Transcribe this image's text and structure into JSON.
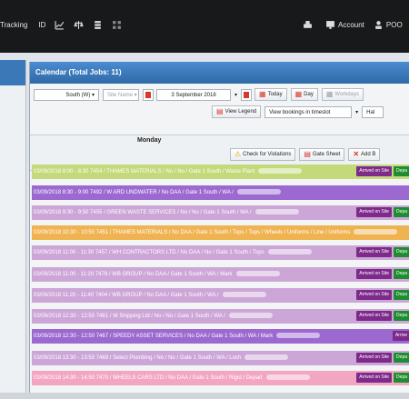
{
  "topbar": {
    "items": [
      "Tracking",
      "ID"
    ],
    "account_label": "Account",
    "user_label": "POO",
    "icons": [
      "chart-icon",
      "scales-icon",
      "stack-icon",
      "grid-icon",
      "printer-icon",
      "monitor-icon",
      "user-icon"
    ]
  },
  "calendar": {
    "title": "Calendar (Total Jobs: 11)",
    "location_select": "South (W) ▾",
    "site_select": "Site Name ▾",
    "date_select": "3 September 2018",
    "today_label": "Today",
    "day_label": "Day",
    "workdays_label": "Workdays",
    "view_legend_label": "View Legend",
    "view_bookings_select": "View bookings in timeslot",
    "hour_select": "Hal",
    "day_name": "Monday",
    "check_violations_label": "Check for Violations",
    "gate_sheet_label": "Gate Sheet",
    "add_label": "Add B",
    "rows": [
      {
        "text": "03/09/2018 8:00 - 8:30 7454 / THAMES MATERIALS / No / No / Gate 1 South / Waste Plant",
        "color": "#c3d97a",
        "tags": [
          "Arrived on Site",
          "Depa"
        ]
      },
      {
        "text": "03/09/2018 8:30 - 9:00 7492 / W ARD UNDWATER / No DAA / Gate 1 South / WA /",
        "color": "#9c69d0",
        "tags": []
      },
      {
        "text": "03/09/2018 9:30 - 9:50 7455 / GREEN WASTE SERVICES / No / No / Gate 1 South / WA /",
        "color": "#cda6d8",
        "tags": [
          "Arrived on Site",
          "Depa"
        ]
      },
      {
        "text": "03/09/2018 10:30 - 10:50 7451 / THAMES MATERIALS / No DAA / Gate 1 South / Tops / Tops / Wheels / Uniforms / Line / Uniforms",
        "color": "#f0b352",
        "tags": []
      },
      {
        "text": "03/09/2018 11:00 - 11:30 7457 / WH CONTRACTORS LTD / No DAA / No / Gate 1 South / Tops",
        "color": "#cda6d8",
        "tags": [
          "Arrived on Site",
          "Depa"
        ]
      },
      {
        "text": "03/09/2018 11:00 - 11:20 7478 / WB GROUP / No DAA / Gate 1 South / WA / Mark",
        "color": "#cda6d8",
        "tags": [
          "Arrived on Site",
          "Depa"
        ]
      },
      {
        "text": "03/09/2018 11:20 - 11:40 7404 / WB GROUP / No DAA / Gate 1 South / WA /",
        "color": "#cda6d8",
        "tags": [
          "Arrived on Site",
          "Depa"
        ]
      },
      {
        "text": "03/09/2018 12:30 - 12:50 7481 / W Shipping Ltd / No / No / Gate 1 South / WA /",
        "color": "#cda6d8",
        "tags": [
          "Arrived on Site",
          "Depa"
        ]
      },
      {
        "text": "03/09/2018 12:30 - 12:50 7467 / SPEEDY ASSET SERVICES / No DAA / Gate 1 South / WA / Mark",
        "color": "#9c69d0",
        "tags": [
          "Arrive"
        ]
      },
      {
        "text": "03/09/2018 13:30 - 13:50 7469 / Select Plumbing / No / No / Gate 1 South / WA / Loch",
        "color": "#cda6d8",
        "tags": [
          "Arrived on Site",
          "Depa"
        ]
      },
      {
        "text": "03/09/2018 14:30 - 14:50 7470 / WHEELS CARS LTD / No DAA / Gate 1 South / Rigid / Depart",
        "color": "#f3a6c1",
        "tags": [
          "Arrived on Site",
          "Depa"
        ]
      }
    ]
  }
}
